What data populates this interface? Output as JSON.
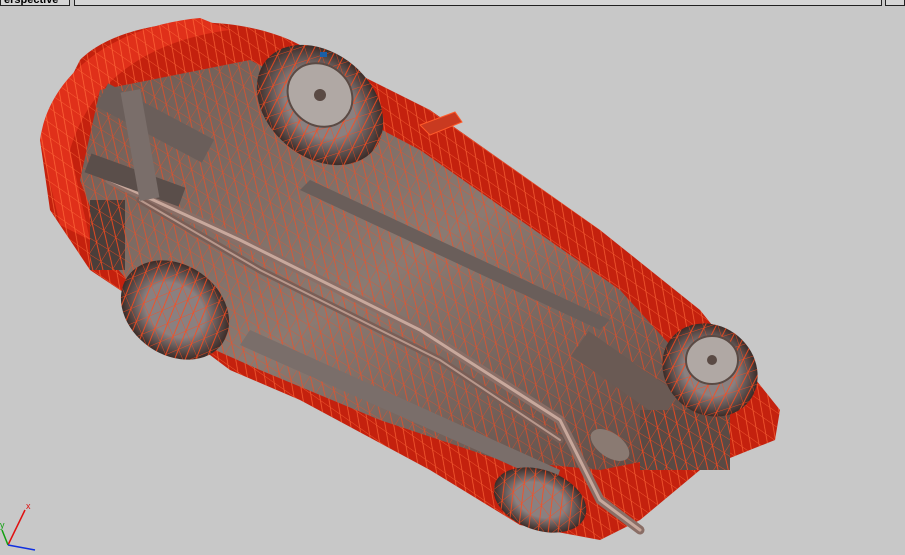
{
  "viewport": {
    "label": "Perspective",
    "label_visible": "erspective",
    "mode_label": "",
    "background": "#c8c8c8"
  },
  "gizmo": {
    "x_label": "x",
    "y_label": "y",
    "z_label": "z",
    "x_color": "#e01010",
    "y_color": "#10a010",
    "z_color": "#1030e0"
  },
  "model": {
    "wireframe_color": "#ff3a10",
    "body_color": "#cc1a0a"
  }
}
